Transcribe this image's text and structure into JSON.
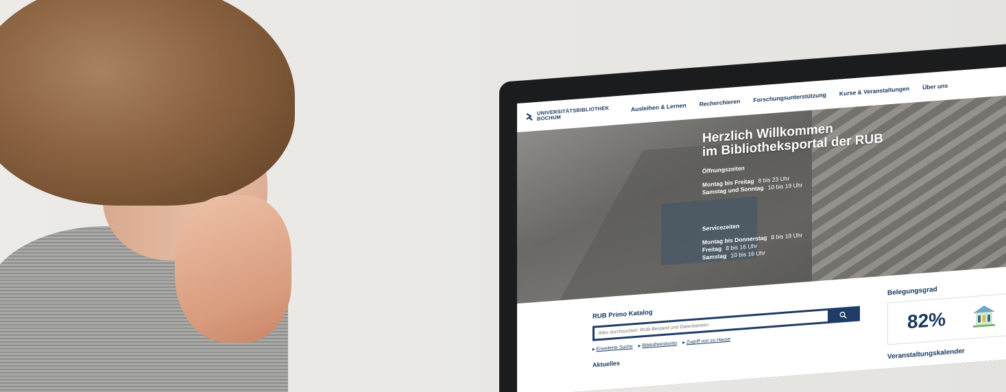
{
  "header": {
    "logo_line1": "UNIVERSITÄTSBIBLIOTHEK",
    "logo_line2": "BOCHUM",
    "nav": [
      "Ausleihen & Lernen",
      "Recherchieren",
      "Forschungsunterstützung",
      "Kurse & Veranstaltungen",
      "Über uns"
    ]
  },
  "hero": {
    "title_line1": "Herzlich Willkommen",
    "title_line2": "im Bibliotheksportal der RUB",
    "opening_heading": "Öffnungszeiten",
    "opening": [
      {
        "days": "Montag bis Freitag",
        "time": "8 bis 23 Uhr"
      },
      {
        "days": "Samstag und Sonntag",
        "time": "10 bis 19 Uhr"
      }
    ],
    "service_heading": "Servicezeiten",
    "service": [
      {
        "days": "Montag bis Donnerstag",
        "time": "8 bis 18 Uhr"
      },
      {
        "days": "Freitag",
        "time": "8 bis 16 Uhr"
      },
      {
        "days": "Samstag",
        "time": "10 bis 16 Uhr"
      }
    ]
  },
  "catalog": {
    "title": "RUB Primo Katalog",
    "search_placeholder": "Alles durchsuchen: RUB-Bestand und Datenbanken",
    "links": [
      "Erweiterte Suche",
      "Bibliothekskonto",
      "Zugriff von zu Hause"
    ],
    "news_heading": "Aktuelles"
  },
  "occupancy": {
    "title": "Belegungsgrad",
    "value": "82%",
    "calendar_heading": "Veranstaltungskalender"
  },
  "colors": {
    "brand_navy": "#17365d",
    "search_bar": "#1f3c66"
  }
}
